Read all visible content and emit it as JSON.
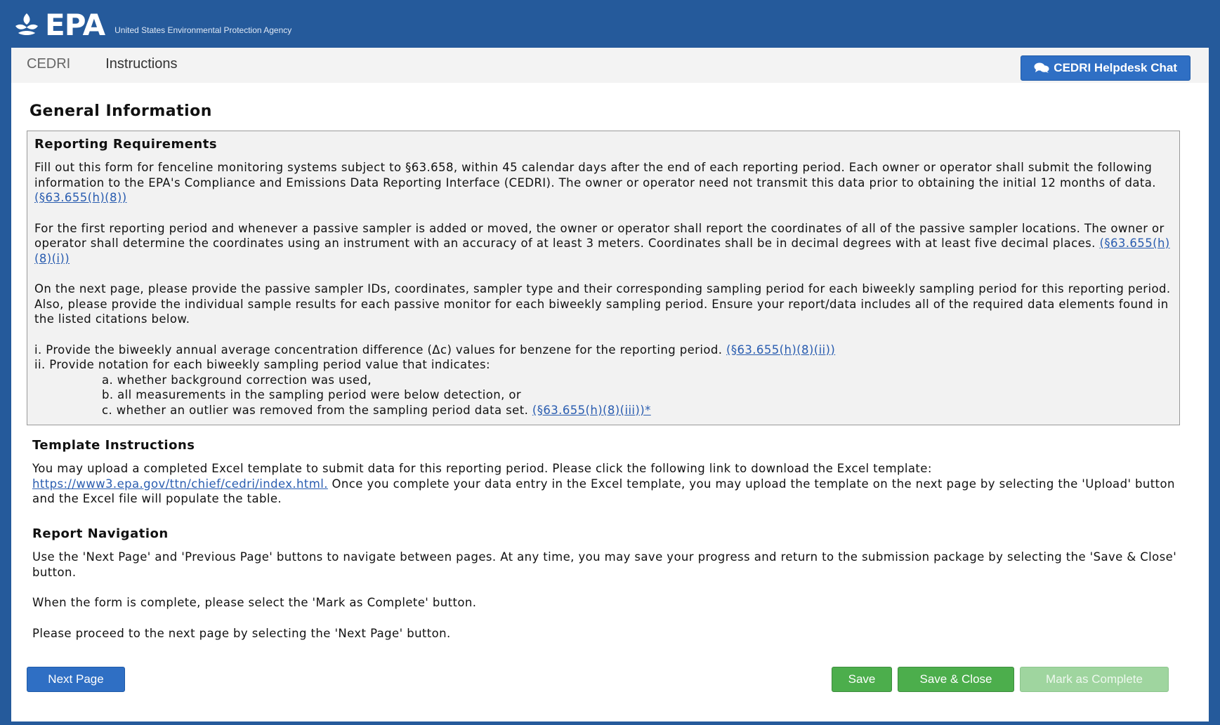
{
  "header": {
    "logo_text": "EPA",
    "agency": "United States Environmental Protection Agency"
  },
  "breadcrumb": [
    "CEDRI",
    "Instructions"
  ],
  "helpdesk_button": "CEDRI Helpdesk Chat",
  "section_title": "General Information",
  "reporting": {
    "title": "Reporting Requirements",
    "p1": "Fill out this form for fenceline monitoring systems subject to §63.658, within 45 calendar days after the end of each reporting period. Each owner or operator shall submit the following information to the EPA's Compliance and Emissions Data Reporting Interface (CEDRI). The owner or operator need not transmit this data prior to obtaining the initial 12 months of data.",
    "p1_cite": "(§63.655(h)(8))",
    "p2": "For the first reporting period and whenever a passive sampler is added or moved, the owner or operator shall report the coordinates of all of the passive sampler locations. The owner or operator shall determine the coordinates using an instrument with an accuracy of at least 3 meters. Coordinates shall be in decimal degrees with at least five decimal places.",
    "p2_cite": "(§63.655(h)(8)(i))",
    "p3": "On the next page, please provide the passive sampler IDs, coordinates, sampler type and their corresponding sampling period for each biweekly sampling period for this reporting period. Also, please provide the individual sample results for each passive monitor for each biweekly sampling period. Ensure your report/data includes all of the required data elements found in the listed citations below.",
    "item_i": "i. Provide the biweekly annual average concentration difference (Δc) values for benzene for the reporting period.",
    "item_i_cite": "(§63.655(h)(8)(ii))",
    "item_ii": "ii. Provide notation for each biweekly sampling period value that indicates:",
    "item_a": "a. whether background correction was used,",
    "item_b": "b. all measurements in the sampling period were below detection, or",
    "item_c": "c. whether an outlier was removed from the sampling period data set.",
    "item_c_cite": "(§63.655(h)(8)(iii))*"
  },
  "template": {
    "title": "Template Instructions",
    "text_before": "You may upload a completed Excel template to submit data for this reporting period. Please click the following link to download the Excel template:",
    "link": "https://www3.epa.gov/ttn/chief/cedri/index.html.",
    "text_after": "Once you complete your data entry in the Excel template, you may upload the template on the next page by selecting the 'Upload' button and the Excel file will populate the table."
  },
  "navigation": {
    "title": "Report Navigation",
    "p1": "Use the 'Next Page' and 'Previous Page' buttons to navigate between pages. At any time, you may save your progress and return to the submission package by selecting the 'Save & Close' button.",
    "p2": "When the form is complete, please select the 'Mark as Complete' button.",
    "p3": "Please proceed to the next page by selecting the 'Next Page' button."
  },
  "buttons": {
    "next": "Next Page",
    "save": "Save",
    "save_close": "Save & Close",
    "mark_complete": "Mark as Complete"
  }
}
